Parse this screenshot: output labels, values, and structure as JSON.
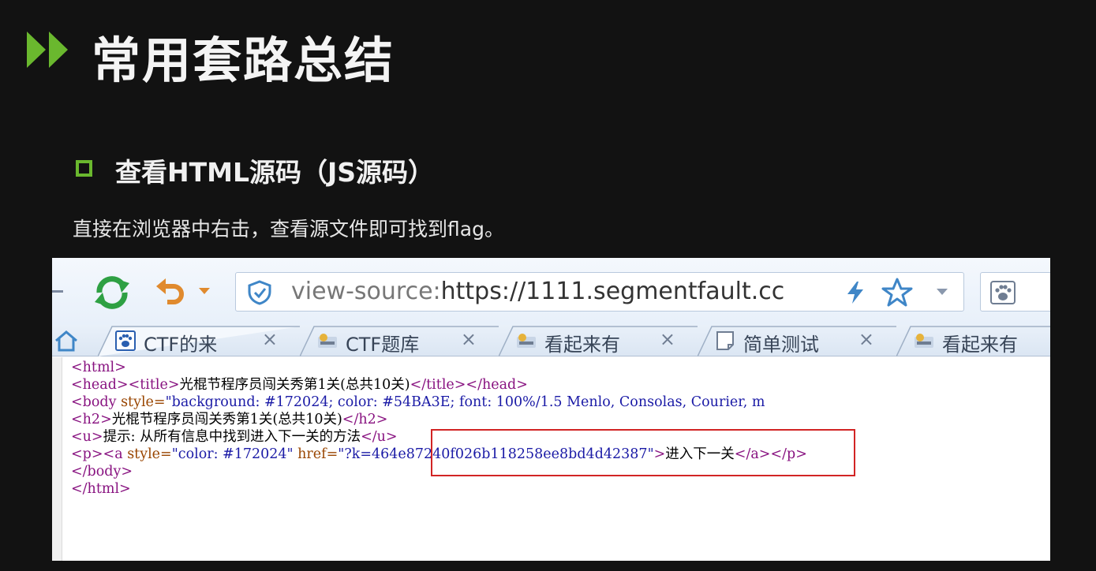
{
  "slide": {
    "title": "常用套路总结",
    "subtitle": "查看HTML源码（JS源码）",
    "body": "直接在浏览器中右击，查看源文件即可找到flag。",
    "accent_color": "#6ab82e"
  },
  "browser": {
    "url": {
      "prefix": "view-source:",
      "rest": "https://1111.segmentfault.cc"
    },
    "icons": [
      "refresh-icon",
      "undo-icon",
      "shield-icon",
      "bolt-icon",
      "star-icon",
      "paw-search-icon",
      "home-icon"
    ],
    "tabs": [
      {
        "label": "CTF的来",
        "icon": "paw-icon"
      },
      {
        "label": "CTF题库",
        "icon": "site-icon"
      },
      {
        "label": "看起来有",
        "icon": "site-icon"
      },
      {
        "label": "简单测试",
        "icon": "page-icon"
      },
      {
        "label": "看起来有",
        "icon": "site-icon"
      }
    ],
    "tab_close": "×",
    "source": {
      "l1": "<html>",
      "l2_open": "<head><title>",
      "l2_text": "光棍节程序员闯关秀第1关(总共10关)",
      "l2_close": "</title></head>",
      "l3_tag": "<body",
      "l3_attr": " style=",
      "l3_val": "\"background: #172024; color: #54BA3E; font: 100%/1.5 Menlo, Consolas, Courier, m",
      "l4_open": "<h2>",
      "l4_text": "光棍节程序员闯关秀第1关(总共10关)",
      "l4_close": "</h2>",
      "l5_open": "<u>",
      "l5_text": "提示: 从所有信息中找到进入下一关的方法",
      "l5_close": "</u>",
      "l6_tag1": "<p><a",
      "l6_attr1": " style=",
      "l6_val1": "\"color: #172024\"",
      "l6_attr2": " href=",
      "l6_val2": "\"?k=464e87240f026b118258ee8bd4d42387\"",
      "l6_tag2": ">",
      "l6_text": "进入下一关",
      "l6_close": "</a></p>",
      "l7": "</body>",
      "l8": "</html>"
    }
  }
}
